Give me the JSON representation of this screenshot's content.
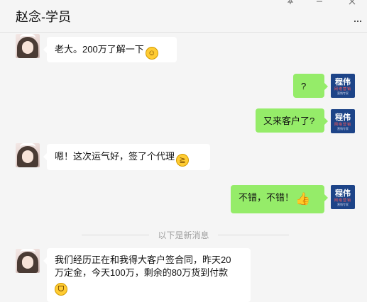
{
  "header": {
    "title": "赵念-学员",
    "icons": [
      "pin-icon",
      "minimize-icon",
      "close-icon",
      "more-icon"
    ],
    "more_label": "···"
  },
  "avatar_right": {
    "line1": "程伟",
    "line2": "网络营销",
    "line3": "营销专家"
  },
  "messages": [
    {
      "side": "left",
      "text": "老大。200万了解一下",
      "emoji": "grinning-face-icon"
    },
    {
      "side": "right",
      "text": "?"
    },
    {
      "side": "right",
      "text": "又来客户了?"
    },
    {
      "side": "left",
      "text": "嗯！这次运气好，签了个代理",
      "emoji": "grinning-squint-icon"
    },
    {
      "side": "right",
      "text": "不错，不错！",
      "emoji": "thumbs-up-icon"
    },
    {
      "side": "left",
      "lines": [
        "我们经历正在和我得大客户签合同，昨天20",
        "万定金，今天100万，剩余的80万货到付款"
      ],
      "emoji": "grin-icon"
    }
  ],
  "divider": {
    "text": "以下是新消息"
  },
  "colors": {
    "background": "#f5f5f5",
    "bubble_self": "#95ec69",
    "bubble_other": "#ffffff",
    "divider_text": "#a0a0a0"
  }
}
